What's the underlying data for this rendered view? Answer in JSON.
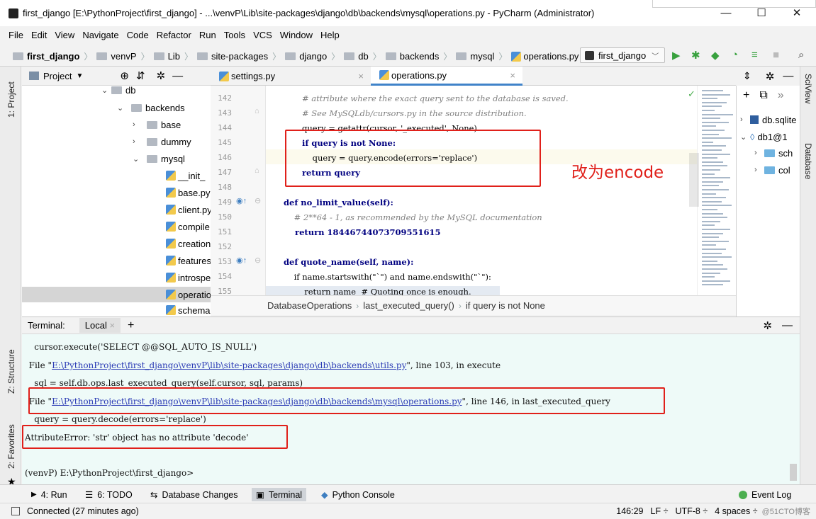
{
  "window": {
    "title": "first_django [E:\\PythonProject\\first_django] - ...\\venvP\\Lib\\site-packages\\django\\db\\backends\\mysql\\operations.py - PyCharm (Administrator)",
    "minimize": "—",
    "maximize": "☐",
    "close": "✕"
  },
  "menu": [
    "File",
    "Edit",
    "View",
    "Navigate",
    "Code",
    "Refactor",
    "Run",
    "Tools",
    "VCS",
    "Window",
    "Help"
  ],
  "breadcrumbs": [
    "first_django",
    "venvP",
    "Lib",
    "site-packages",
    "django",
    "db",
    "backends",
    "mysql",
    "operations.py"
  ],
  "run_config": "first_django",
  "project_panel": {
    "title": "Project",
    "items": [
      {
        "label": "db",
        "kind": "folder",
        "open": true
      },
      {
        "label": "backends",
        "kind": "folder",
        "open": true
      },
      {
        "label": "base",
        "kind": "folder",
        "open": false
      },
      {
        "label": "dummy",
        "kind": "folder",
        "open": false
      },
      {
        "label": "mysql",
        "kind": "folder",
        "open": true
      },
      {
        "label": "__init_",
        "kind": "py"
      },
      {
        "label": "base.py",
        "kind": "py"
      },
      {
        "label": "client.py",
        "kind": "py"
      },
      {
        "label": "compile",
        "kind": "py"
      },
      {
        "label": "creation",
        "kind": "py"
      },
      {
        "label": "features",
        "kind": "py"
      },
      {
        "label": "introspe",
        "kind": "py"
      },
      {
        "label": "operatio",
        "kind": "py",
        "selected": true
      },
      {
        "label": "schema",
        "kind": "py"
      }
    ]
  },
  "tabs": [
    {
      "label": "settings.py",
      "active": false
    },
    {
      "label": "operations.py",
      "active": true
    }
  ],
  "code": {
    "line_numbers": [
      "142",
      "143",
      "144",
      "145",
      "146",
      "147",
      "148",
      "149",
      "150",
      "151",
      "152",
      "153",
      "154",
      "155"
    ],
    "lines": [
      "# attribute where the exact query sent to the database is saved.",
      "# See MySQLdb/cursors.py in the source distribution.",
      "query = getattr(cursor, '_executed', None)",
      "if query is not None:",
      "    query = query.encode(errors='replace')",
      "return query",
      "",
      "def no_limit_value(self):",
      "    # 2**64 - 1, as recommended by the MySQL documentation",
      "    return 18446744073709551615",
      "",
      "def quote_name(self, name):",
      "    if name.startswith(\"`\") and name.endswith(\"`\"):",
      "        return name  # Quoting once is enough."
    ]
  },
  "annotation": "改为encode",
  "editor_breadcrumb": [
    "DatabaseOperations",
    "last_executed_query()",
    "if query is not None"
  ],
  "db_panel": {
    "items": [
      "db.sqlite",
      "db1@1",
      "sch",
      "col"
    ]
  },
  "terminal": {
    "header": "Terminal:",
    "tab": "Local",
    "lines": [
      "    cursor.execute('SELECT @@SQL_AUTO_IS_NULL')",
      "  File \"E:\\PythonProject\\first_django\\venvP\\lib\\site-packages\\django\\db\\backends\\utils.py\", line 103, in execute",
      "    sql = self.db.ops.last_executed_query(self.cursor, sql, params)",
      "  File \"E:\\PythonProject\\first_django\\venvP\\lib\\site-packages\\django\\db\\backends\\mysql\\operations.py\", line 146, in last_executed_query",
      "    query = query.decode(errors='replace')",
      "AttributeError: 'str' object has no attribute 'decode'",
      "",
      "(venvP) E:\\PythonProject\\first_django>"
    ],
    "link1": "E:\\PythonProject\\first_django\\venvP\\lib\\site-packages\\django\\db\\backends\\utils.py",
    "link2": "E:\\PythonProject\\first_django\\venvP\\lib\\site-packages\\django\\db\\backends\\mysql\\operations.py"
  },
  "left_stripe": [
    "1: Project",
    "Z: Structure",
    "2: Favorites"
  ],
  "right_stripe": [
    "SciView",
    "Database"
  ],
  "bottom_tools": [
    {
      "label": "4: Run"
    },
    {
      "label": "6: TODO"
    },
    {
      "label": "Database Changes"
    },
    {
      "label": "Terminal",
      "active": true
    },
    {
      "label": "Python Console"
    }
  ],
  "event_log": "Event Log",
  "status": {
    "left": "Connected (27 minutes ago)",
    "position": "146:29",
    "line_sep": "LF ÷",
    "encoding": "UTF-8 ÷",
    "indent": "4 spaces ÷",
    "watermark": "@51CTO博客"
  }
}
